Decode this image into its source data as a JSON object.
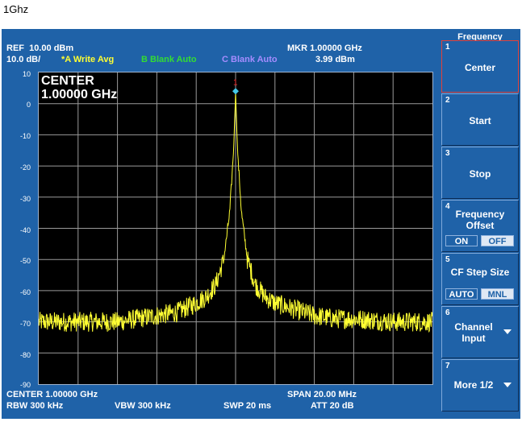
{
  "caption": "1Ghz",
  "header": {
    "ref": "REF",
    "ref_value": "10.00 dBm",
    "scale": "10.0 dB/",
    "trace_a": "*A Write Avg",
    "trace_b": "B Blank Auto",
    "trace_c": "C Blank Auto",
    "mkr": "MKR 1.00000 GHz",
    "mkr_level": "3.99 dBm"
  },
  "display": {
    "center_title": "CENTER",
    "center_value": "1.00000 GHz",
    "marker_number": "1"
  },
  "footer": {
    "center": "CENTER 1.00000 GHz",
    "span": "SPAN 20.00 MHz",
    "rbw": "RBW  300 kHz",
    "vbw": "VBW  300 kHz",
    "swp": "SWP  20 ms",
    "att": "ATT  20 dB"
  },
  "softkeys": {
    "menu_title": "Frequency",
    "keys": [
      {
        "num": "1",
        "line1": "Center",
        "line2": ""
      },
      {
        "num": "2",
        "line1": "Start",
        "line2": ""
      },
      {
        "num": "3",
        "line1": "Stop",
        "line2": ""
      },
      {
        "num": "4",
        "line1": "Frequency",
        "line2": "Offset",
        "opt_a": "ON",
        "opt_b": "OFF",
        "selected": "OFF"
      },
      {
        "num": "5",
        "line1": "CF Step Size",
        "line2": "",
        "opt_a": "AUTO",
        "opt_b": "MNL",
        "selected": "MNL"
      },
      {
        "num": "6",
        "line1": "Channel",
        "line2": "Input"
      },
      {
        "num": "7",
        "line1": "More 1/2",
        "line2": ""
      }
    ]
  },
  "chart_data": {
    "type": "line",
    "title": "",
    "xlabel": "",
    "ylabel": "",
    "x_range_mhz": [
      990,
      1010
    ],
    "ylim": [
      -90,
      10
    ],
    "y_ticks": [
      "10",
      "0",
      "-10",
      "-20",
      "-30",
      "-40",
      "-50",
      "-60",
      "-70",
      "-80",
      "-90"
    ],
    "grid": true,
    "series": [
      {
        "color": "#ffff33",
        "x": [
          990,
          992,
          994,
          995,
          996,
          997,
          998,
          998.5,
          999,
          999.4,
          999.7,
          999.9,
          1000,
          1000.1,
          1000.3,
          1000.6,
          1001,
          1001.5,
          1002,
          1003,
          1004,
          1005,
          1006,
          1008,
          1010
        ],
        "values": [
          -70,
          -70,
          -70,
          -69,
          -68,
          -67,
          -64,
          -62,
          -58,
          -50,
          -35,
          -15,
          4,
          -15,
          -35,
          -50,
          -58,
          -62,
          -64,
          -66,
          -68,
          -69,
          -69,
          -70,
          -70
        ]
      }
    ],
    "marker": {
      "x": 1000,
      "y": 3.99
    }
  }
}
